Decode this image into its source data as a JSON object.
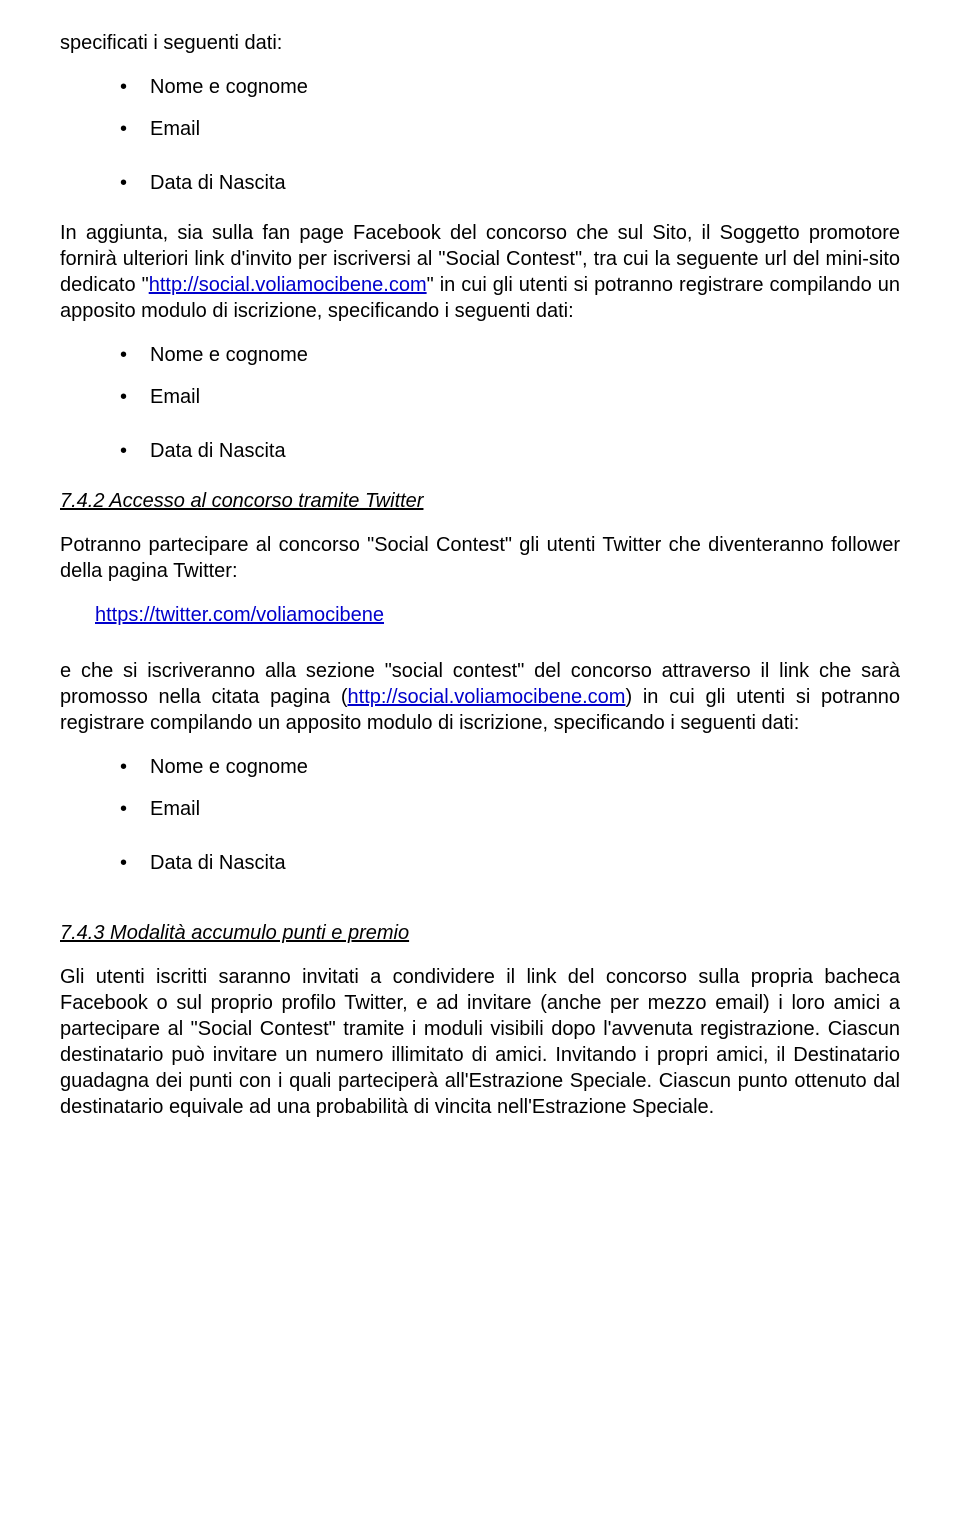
{
  "intro1": "specificati i seguenti dati:",
  "list1": {
    "i0": "Nome e cognome",
    "i1": "Email",
    "i2": "Data di Nascita"
  },
  "para1": {
    "t0": "In aggiunta, sia sulla fan page Facebook del concorso che sul Sito, il Soggetto promotore fornirà ulteriori link d'invito per iscriversi al \"Social Contest\", tra cui la seguente url del mini-sito dedicato \"",
    "link": "http://social.voliamocibene.com",
    "t1": "\" in cui gli utenti si potranno registrare compilando un apposito modulo di iscrizione, specificando i seguenti dati:"
  },
  "list2": {
    "i0": "Nome e cognome",
    "i1": "Email",
    "i2": "Data di Nascita"
  },
  "h742": "7.4.2 Accesso al concorso tramite Twitter",
  "para2": "Potranno partecipare al concorso \"Social Contest\" gli utenti Twitter che diventeranno follower della pagina Twitter:",
  "twlink": "https://twitter.com/voliamocibene",
  "para3": {
    "t0": "e che si iscriveranno alla sezione \"social contest\" del concorso attraverso il link che sarà promosso nella citata pagina (",
    "link": "http://social.voliamocibene.com",
    "t1": ") in cui gli utenti si potranno registrare compilando un apposito modulo di iscrizione, specificando i seguenti dati:"
  },
  "list3": {
    "i0": "Nome e cognome",
    "i1": "Email",
    "i2": "Data di Nascita"
  },
  "h743": "7.4.3 Modalità accumulo punti e premio",
  "para4": "Gli utenti iscritti saranno invitati a condividere il link del concorso sulla propria bacheca Facebook o sul proprio profilo Twitter, e ad invitare (anche per mezzo email) i loro amici a partecipare al \"Social Contest\" tramite i moduli visibili dopo l'avvenuta registrazione. Ciascun destinatario può invitare un numero illimitato di amici. Invitando i propri amici, il Destinatario guadagna dei punti con i quali parteciperà all'Estrazione Speciale. Ciascun punto ottenuto dal destinatario equivale ad una probabilità di vincita nell'Estrazione Speciale."
}
